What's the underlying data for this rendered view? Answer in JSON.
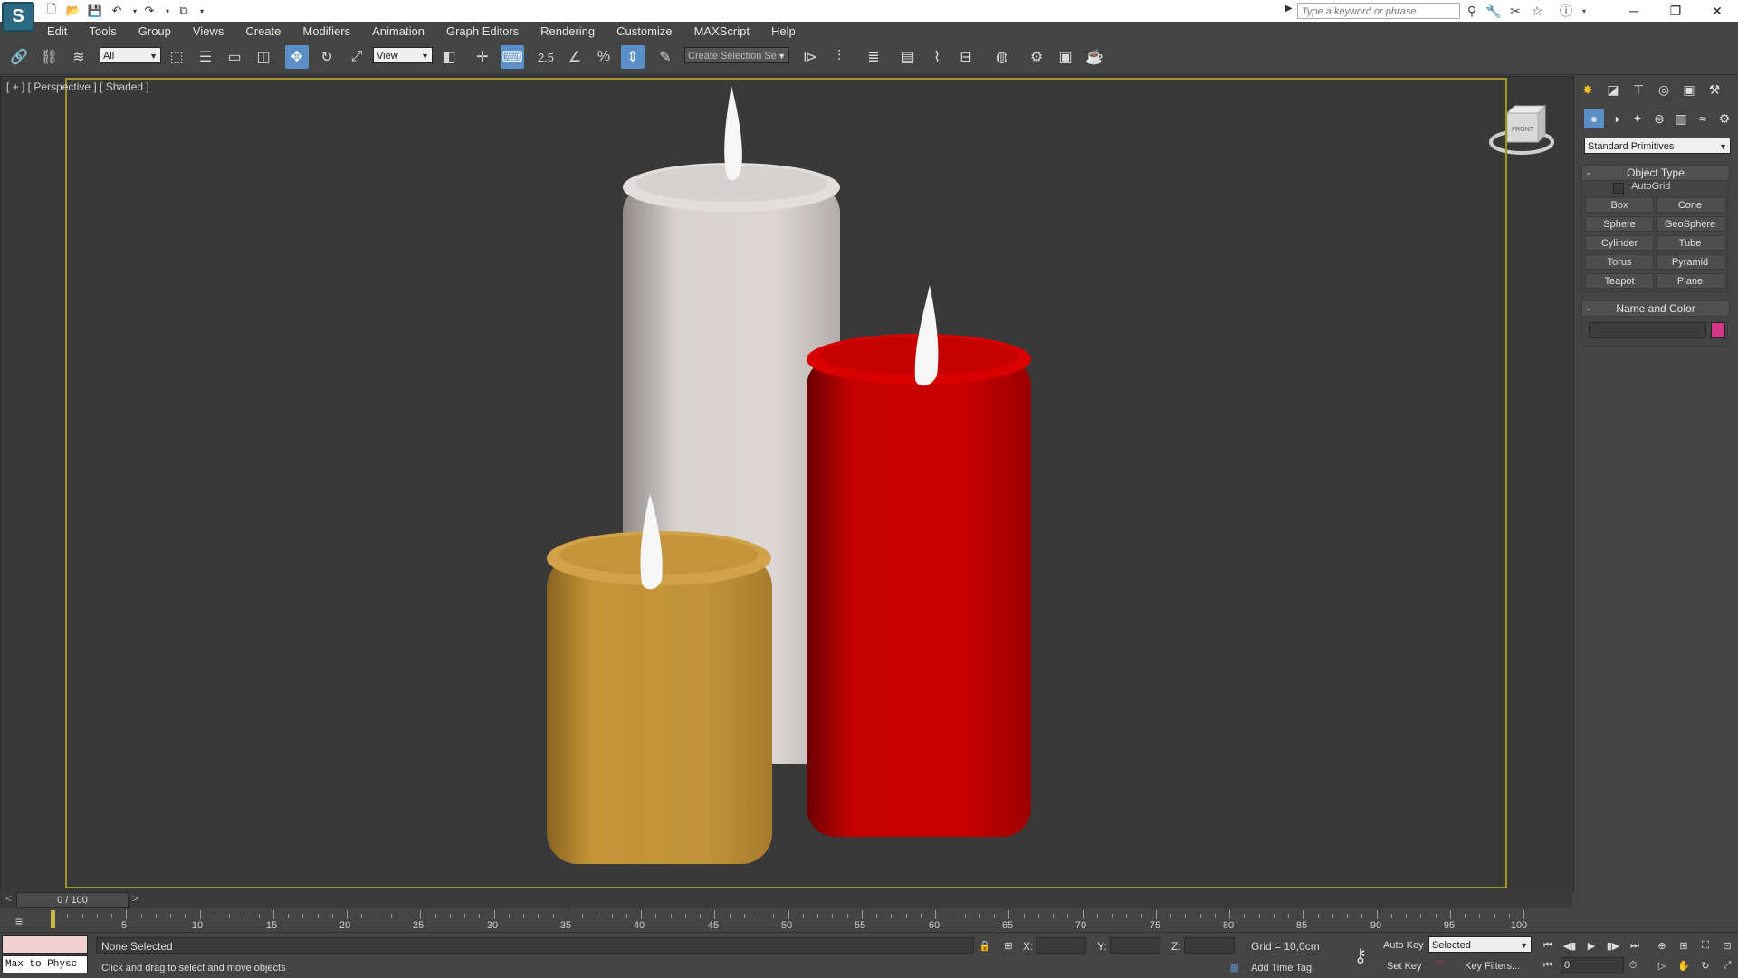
{
  "titlebar": {
    "logo": "S",
    "search_placeholder": "Type a keyword or phrase",
    "quick_access": [
      "new-file-icon",
      "open-folder-icon",
      "save-icon",
      "undo-icon",
      "redo-icon",
      "project-icon",
      "dropdown-icon"
    ],
    "window_controls": {
      "minimize": "─",
      "restore": "❐",
      "close": "✕"
    }
  },
  "menu": [
    "Edit",
    "Tools",
    "Group",
    "Views",
    "Create",
    "Modifiers",
    "Animation",
    "Graph Editors",
    "Rendering",
    "Customize",
    "MAXScript",
    "Help"
  ],
  "toolbar": {
    "selection_filter": "All",
    "reference_coord": "View",
    "snap_value": "2.5",
    "named_selection_placeholder": "Create Selection Se"
  },
  "viewport": {
    "label": "[ + ] [ Perspective ] [ Shaded ]",
    "viewcube_face": "FRONT"
  },
  "command_panel": {
    "category": "Standard Primitives",
    "object_type_header": "Object Type",
    "autogrid_label": "AutoGrid",
    "buttons": [
      "Box",
      "Cone",
      "Sphere",
      "GeoSphere",
      "Cylinder",
      "Tube",
      "Torus",
      "Pyramid",
      "Teapot",
      "Plane"
    ],
    "name_color_header": "Name and Color",
    "object_color": "#d6358a"
  },
  "timeslider": {
    "frame_label": "0 / 100",
    "prev": "<",
    "next": ">"
  },
  "trackbar": {
    "labels": [
      "5",
      "10",
      "15",
      "20",
      "25",
      "30",
      "35",
      "40",
      "45",
      "50",
      "55",
      "60",
      "65",
      "70",
      "75",
      "80",
      "85",
      "90",
      "95",
      "100"
    ]
  },
  "statusbar": {
    "maxscript_mini": "Max to Physc",
    "selection_status": "None Selected",
    "prompt": "Click and drag to select and move objects",
    "x_label": "X:",
    "y_label": "Y:",
    "z_label": "Z:",
    "grid": "Grid = 10,0cm",
    "add_time_tag": "Add Time Tag",
    "auto_key": "Auto Key",
    "set_key": "Set Key",
    "key_mode_value": "Selected",
    "key_filters": "Key Filters...",
    "current_frame": "0"
  },
  "colors": {
    "candle_white": "#d8d3d0",
    "candle_red": "#c80000",
    "candle_gold": "#c49535",
    "safe_frame": "#a49329",
    "active_tool": "#5b8fc7"
  }
}
